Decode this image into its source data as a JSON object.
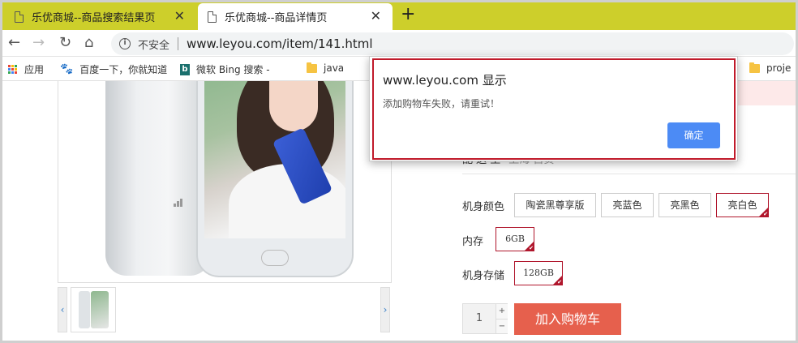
{
  "browser": {
    "tabs": [
      {
        "title": "乐优商城--商品搜索结果页",
        "active": false
      },
      {
        "title": "乐优商城--商品详情页",
        "active": true
      }
    ],
    "new_tab": "+",
    "nav": {
      "back": "←",
      "forward": "→",
      "reload": "↻",
      "home": "⌂"
    },
    "address": {
      "security_text": "不安全",
      "url": "www.leyou.com/item/141.html"
    },
    "bookmarks": [
      {
        "label": "应用",
        "icon": "apps-grid-icon"
      },
      {
        "label": "百度一下，你就知道",
        "icon": "baidu-paw-icon"
      },
      {
        "label": "微软 Bing 搜索 -",
        "icon": "bing-icon"
      },
      {
        "label": "java",
        "icon": "folder-icon"
      },
      {
        "label": "proje",
        "icon": "folder-icon"
      }
    ],
    "accent_color": "#cdcf2b"
  },
  "product": {
    "shipping_label": "配 送 至",
    "shipping_value": "上海 自贡",
    "option_groups": [
      {
        "label": "机身颜色",
        "options": [
          "陶瓷黑尊享版",
          "亮蓝色",
          "亮黑色",
          "亮白色"
        ],
        "selected": "亮白色"
      },
      {
        "label": "内存",
        "options": [
          "6GB"
        ],
        "selected": "6GB"
      },
      {
        "label": "机身存储",
        "options": [
          "128GB"
        ],
        "selected": "128GB"
      }
    ],
    "quantity": "1",
    "qty_plus": "+",
    "qty_minus": "−",
    "add_to_cart": "加入购物车",
    "cart_color": "#e6604d",
    "selected_color": "#b0162c",
    "thumb_prev": "‹",
    "thumb_next": "›"
  },
  "alert": {
    "title": "www.leyou.com 显示",
    "message": "添加购物车失败，请重试！",
    "ok_label": "确定",
    "ok_color": "#4c8bf5"
  }
}
